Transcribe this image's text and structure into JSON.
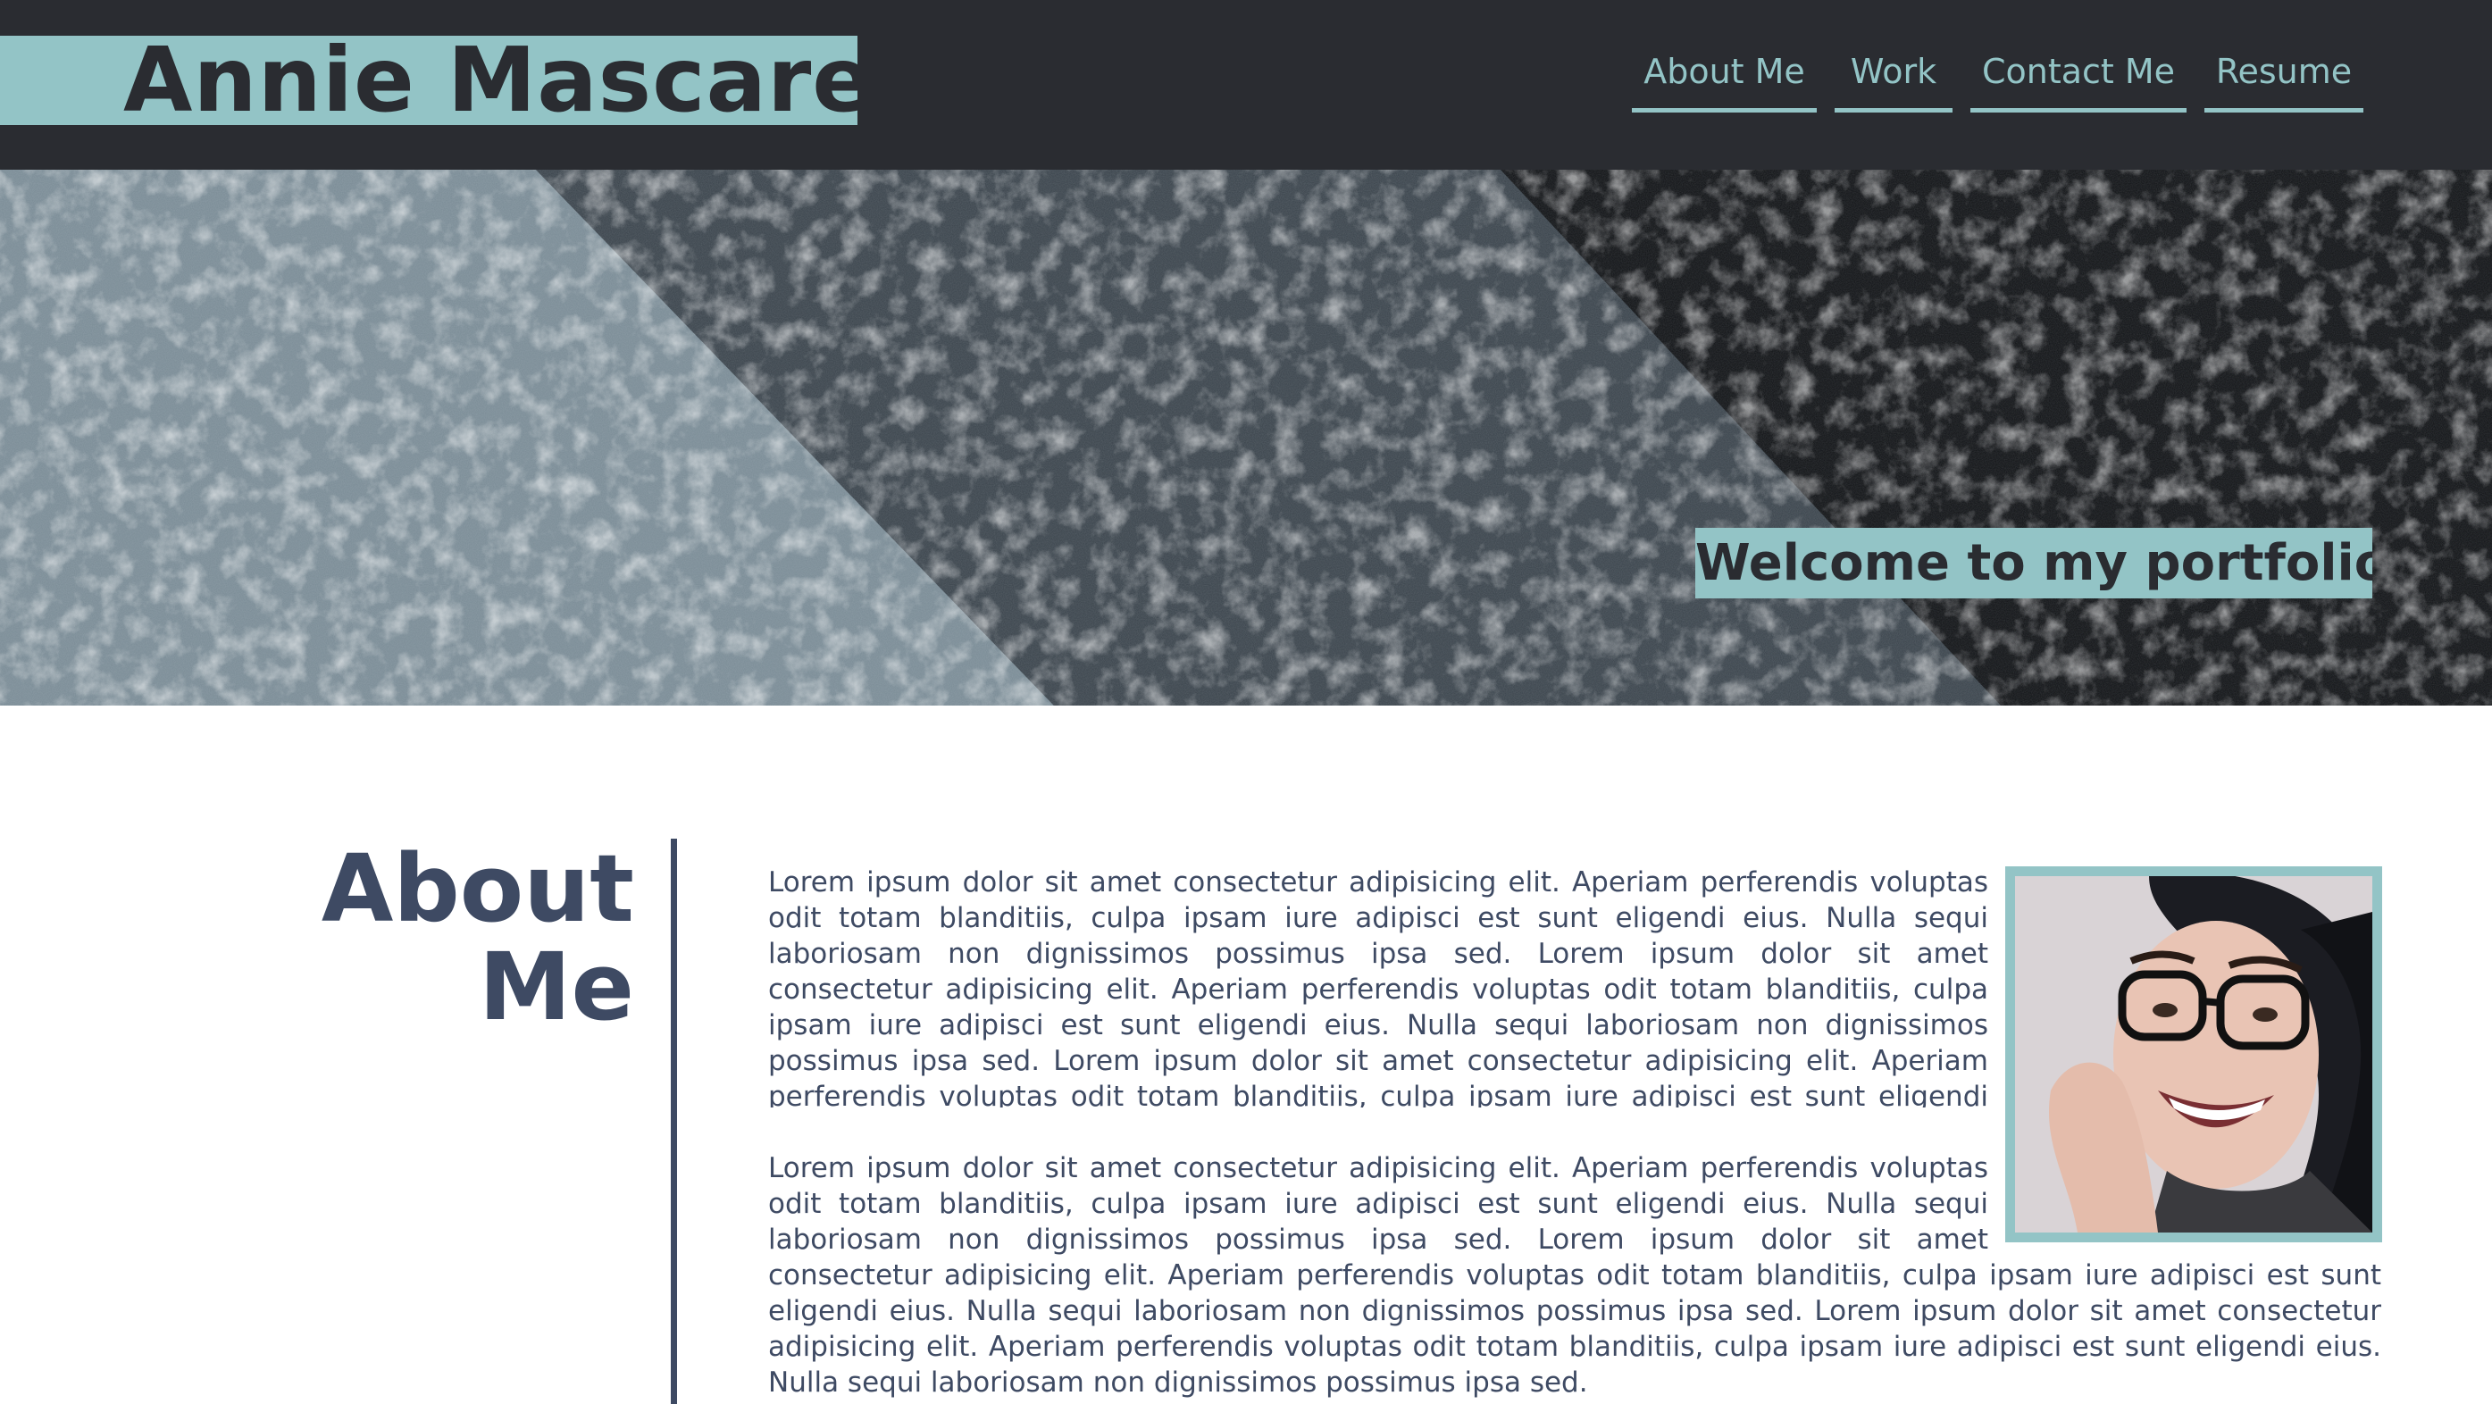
{
  "header": {
    "site_title": "Annie Mascarello",
    "nav": [
      {
        "label": "About Me"
      },
      {
        "label": "Work"
      },
      {
        "label": "Contact Me"
      },
      {
        "label": "Resume"
      }
    ]
  },
  "hero": {
    "tagline": "Welcome to my portfolio!"
  },
  "about": {
    "heading_line1": "About",
    "heading_line2": "Me",
    "paragraphs": [
      "Lorem ipsum dolor sit amet consectetur adipisicing elit. Aperiam perferendis voluptas odit totam blanditiis, culpa ipsam iure adipisci est sunt eligendi eius. Nulla sequi laboriosam non dignissimos possimus ipsa sed. Lorem ipsum dolor sit amet consectetur adipisicing elit. Aperiam perferendis voluptas odit totam blanditiis, culpa ipsam iure adipisci est sunt eligendi eius. Nulla sequi laboriosam non dignissimos possimus ipsa sed. Lorem ipsum dolor sit amet consectetur adipisicing elit. Aperiam perferendis voluptas odit totam blanditiis, culpa ipsam iure adipisci est sunt eligendi eius. Nulla sequi laboriosam non dignissimos possimus ipsa sed.",
      "Lorem ipsum dolor sit amet consectetur adipisicing elit. Aperiam perferendis voluptas odit totam blanditiis, culpa ipsam iure adipisci est sunt eligendi eius. Nulla sequi laboriosam non dignissimos possimus ipsa sed. Lorem ipsum dolor sit amet consectetur adipisicing elit. Aperiam perferendis voluptas odit totam blanditiis, culpa ipsam iure adipisci est sunt eligendi eius. Nulla sequi laboriosam non dignissimos possimus ipsa sed. Lorem ipsum dolor sit amet consectetur adipisicing elit. Aperiam perferendis voluptas odit totam blanditiis, culpa ipsam iure adipisci est sunt eligendi eius. Nulla sequi laboriosam non dignissimos possimus ipsa sed."
    ],
    "photo_icon": "portrait-photo"
  },
  "colors": {
    "header_bg": "#2a2c31",
    "accent": "#93c4c6",
    "text": "#3e4a63"
  }
}
